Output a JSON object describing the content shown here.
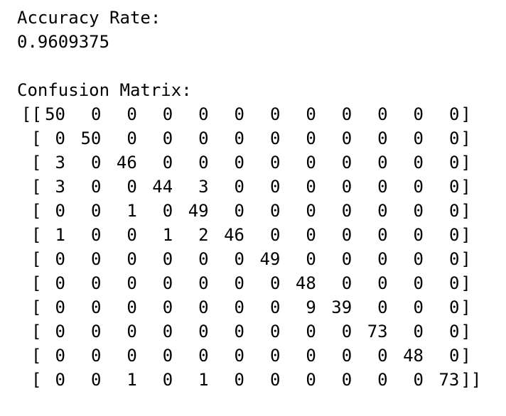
{
  "accuracy_label": "Accuracy Rate:",
  "accuracy_value": "0.9609375",
  "confusion_label": "Confusion Matrix:",
  "matrix": [
    [
      50,
      0,
      0,
      0,
      0,
      0,
      0,
      0,
      0,
      0,
      0,
      0
    ],
    [
      0,
      50,
      0,
      0,
      0,
      0,
      0,
      0,
      0,
      0,
      0,
      0
    ],
    [
      3,
      0,
      46,
      0,
      0,
      0,
      0,
      0,
      0,
      0,
      0,
      0
    ],
    [
      3,
      0,
      0,
      44,
      3,
      0,
      0,
      0,
      0,
      0,
      0,
      0
    ],
    [
      0,
      0,
      1,
      0,
      49,
      0,
      0,
      0,
      0,
      0,
      0,
      0
    ],
    [
      1,
      0,
      0,
      1,
      2,
      46,
      0,
      0,
      0,
      0,
      0,
      0
    ],
    [
      0,
      0,
      0,
      0,
      0,
      0,
      49,
      0,
      0,
      0,
      0,
      0
    ],
    [
      0,
      0,
      0,
      0,
      0,
      0,
      0,
      48,
      0,
      0,
      0,
      0
    ],
    [
      0,
      0,
      0,
      0,
      0,
      0,
      0,
      9,
      39,
      0,
      0,
      0
    ],
    [
      0,
      0,
      0,
      0,
      0,
      0,
      0,
      0,
      0,
      73,
      0,
      0
    ],
    [
      0,
      0,
      0,
      0,
      0,
      0,
      0,
      0,
      0,
      0,
      48,
      0
    ],
    [
      0,
      0,
      1,
      0,
      1,
      0,
      0,
      0,
      0,
      0,
      0,
      73
    ]
  ]
}
